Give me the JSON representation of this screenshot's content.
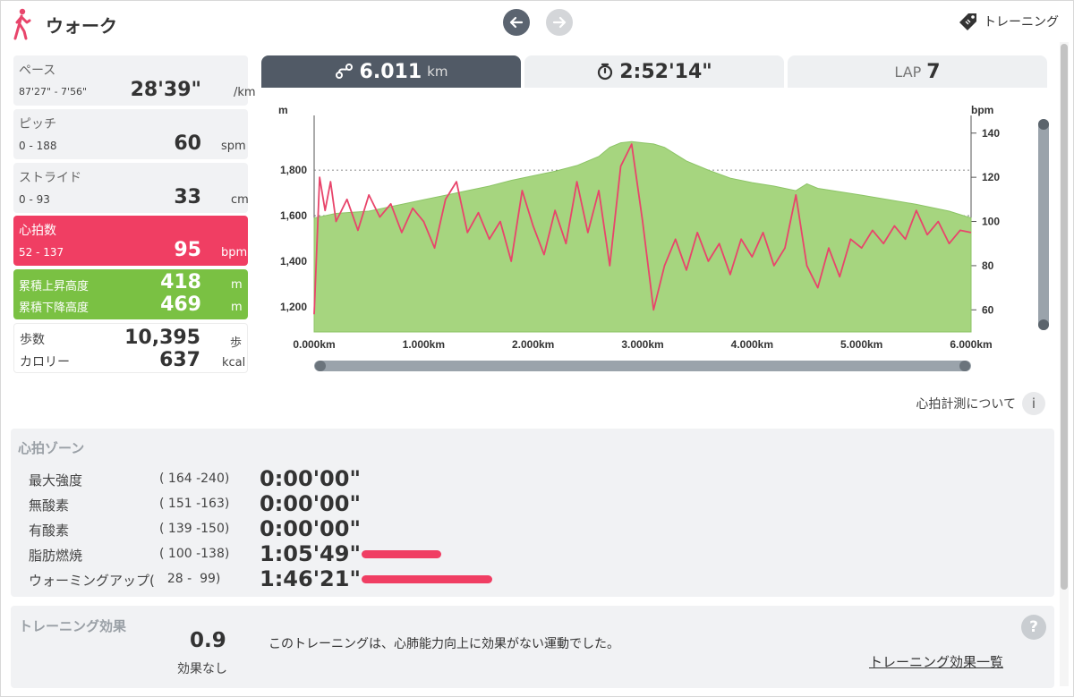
{
  "header": {
    "title": "ウォーク",
    "training_label": "トレーニング"
  },
  "stats": {
    "pace": {
      "label": "ペース",
      "range": "87'27\" - 7'56\"",
      "value": "28'39\"",
      "unit": "/km"
    },
    "pitch": {
      "label": "ピッチ",
      "range": "0 - 188",
      "value": "60",
      "unit": "spm"
    },
    "stride": {
      "label": "ストライド",
      "range": "0 - 93",
      "value": "33",
      "unit": "cm"
    },
    "heart_rate": {
      "label": "心拍数",
      "range": "52 - 137",
      "value": "95",
      "unit": "bpm"
    },
    "elevation": {
      "ascent_label": "累積上昇高度",
      "ascent_value": "418",
      "ascent_unit": "m",
      "descent_label": "累積下降高度",
      "descent_value": "469",
      "descent_unit": "m"
    },
    "other": {
      "steps_label": "歩数",
      "steps_value": "10,395",
      "steps_unit": "歩",
      "calories_label": "カロリー",
      "calories_value": "637",
      "calories_unit": "kcal"
    }
  },
  "tabs": {
    "distance_value": "6.011",
    "distance_unit": "km",
    "time_value": "2:52'14\"",
    "lap_label": "LAP",
    "lap_value": "7"
  },
  "chart_data": {
    "type": "area",
    "x_unit": "km",
    "x_ticks": [
      "0.000km",
      "1.000km",
      "2.000km",
      "3.000km",
      "4.000km",
      "5.000km",
      "6.000km"
    ],
    "xlim": [
      0,
      6
    ],
    "y_left_label": "m",
    "y_left_ticks": [
      "1,200",
      "1,400",
      "1,600",
      "1,800"
    ],
    "y_left_lim": [
      1090,
      2040
    ],
    "y_right_label": "bpm",
    "y_right_ticks": [
      "60",
      "80",
      "100",
      "120",
      "140"
    ],
    "y_right_lim": [
      50,
      148
    ],
    "series": [
      {
        "name": "altitude",
        "axis": "left",
        "color": "#a6d57f",
        "x": [
          0,
          0.2,
          0.5,
          0.8,
          1.0,
          1.3,
          1.6,
          1.8,
          2.0,
          2.2,
          2.4,
          2.6,
          2.7,
          2.8,
          2.9,
          3.0,
          3.1,
          3.2,
          3.3,
          3.4,
          3.6,
          3.8,
          4.0,
          4.2,
          4.4,
          4.5,
          4.6,
          5.0,
          5.5,
          5.8,
          6.0
        ],
        "y": [
          1590,
          1610,
          1620,
          1650,
          1670,
          1700,
          1730,
          1755,
          1775,
          1795,
          1820,
          1860,
          1900,
          1920,
          1925,
          1920,
          1915,
          1900,
          1870,
          1840,
          1800,
          1765,
          1745,
          1730,
          1710,
          1740,
          1720,
          1690,
          1650,
          1620,
          1590
        ]
      },
      {
        "name": "heart_rate",
        "axis": "right",
        "color": "#e8456b",
        "x": [
          0,
          0.05,
          0.1,
          0.15,
          0.2,
          0.3,
          0.4,
          0.5,
          0.6,
          0.7,
          0.8,
          0.9,
          1.0,
          1.1,
          1.2,
          1.3,
          1.4,
          1.5,
          1.6,
          1.7,
          1.8,
          1.9,
          2.0,
          2.1,
          2.2,
          2.3,
          2.4,
          2.5,
          2.6,
          2.7,
          2.8,
          2.9,
          3.0,
          3.1,
          3.2,
          3.3,
          3.4,
          3.5,
          3.6,
          3.7,
          3.8,
          3.9,
          4.0,
          4.1,
          4.2,
          4.3,
          4.4,
          4.5,
          4.6,
          4.7,
          4.8,
          4.9,
          5.0,
          5.1,
          5.2,
          5.3,
          5.4,
          5.5,
          5.6,
          5.7,
          5.8,
          5.9,
          6.0
        ],
        "y": [
          58,
          120,
          105,
          118,
          100,
          110,
          96,
          112,
          102,
          108,
          95,
          106,
          100,
          88,
          110,
          118,
          95,
          104,
          92,
          100,
          82,
          114,
          98,
          85,
          105,
          90,
          118,
          95,
          114,
          80,
          125,
          135,
          100,
          60,
          80,
          92,
          78,
          95,
          82,
          90,
          76,
          92,
          84,
          95,
          80,
          88,
          112,
          80,
          70,
          88,
          75,
          92,
          88,
          96,
          90,
          98,
          92,
          105,
          94,
          100,
          90,
          96,
          95
        ]
      }
    ]
  },
  "chart": {
    "hr_note": "心拍計測について",
    "info_symbol": "i"
  },
  "zones": {
    "title": "心拍ゾーン",
    "rows": [
      {
        "name": "最大強度",
        "range": "( 164 -240)",
        "time": "0:00'00\"",
        "fraction": 0
      },
      {
        "name": "無酸素",
        "range": "( 151 -163)",
        "time": "0:00'00\"",
        "fraction": 0
      },
      {
        "name": "有酸素",
        "range": "( 139 -150)",
        "time": "0:00'00\"",
        "fraction": 0
      },
      {
        "name": "脂肪燃焼",
        "range": "( 100 -138)",
        "time": "1:05'49\"",
        "fraction": 0.61
      },
      {
        "name": "ウォーミングアップ(",
        "range": "  28 -  99)",
        "time": "1:46'21\"",
        "fraction": 1.0
      }
    ]
  },
  "effect": {
    "title": "トレーニング効果",
    "value": "0.9",
    "sub": "効果なし",
    "message": "このトレーニングは、心肺能力向上に効果がない運動でした。",
    "link": "トレーニング効果一覧",
    "help_symbol": "?"
  }
}
